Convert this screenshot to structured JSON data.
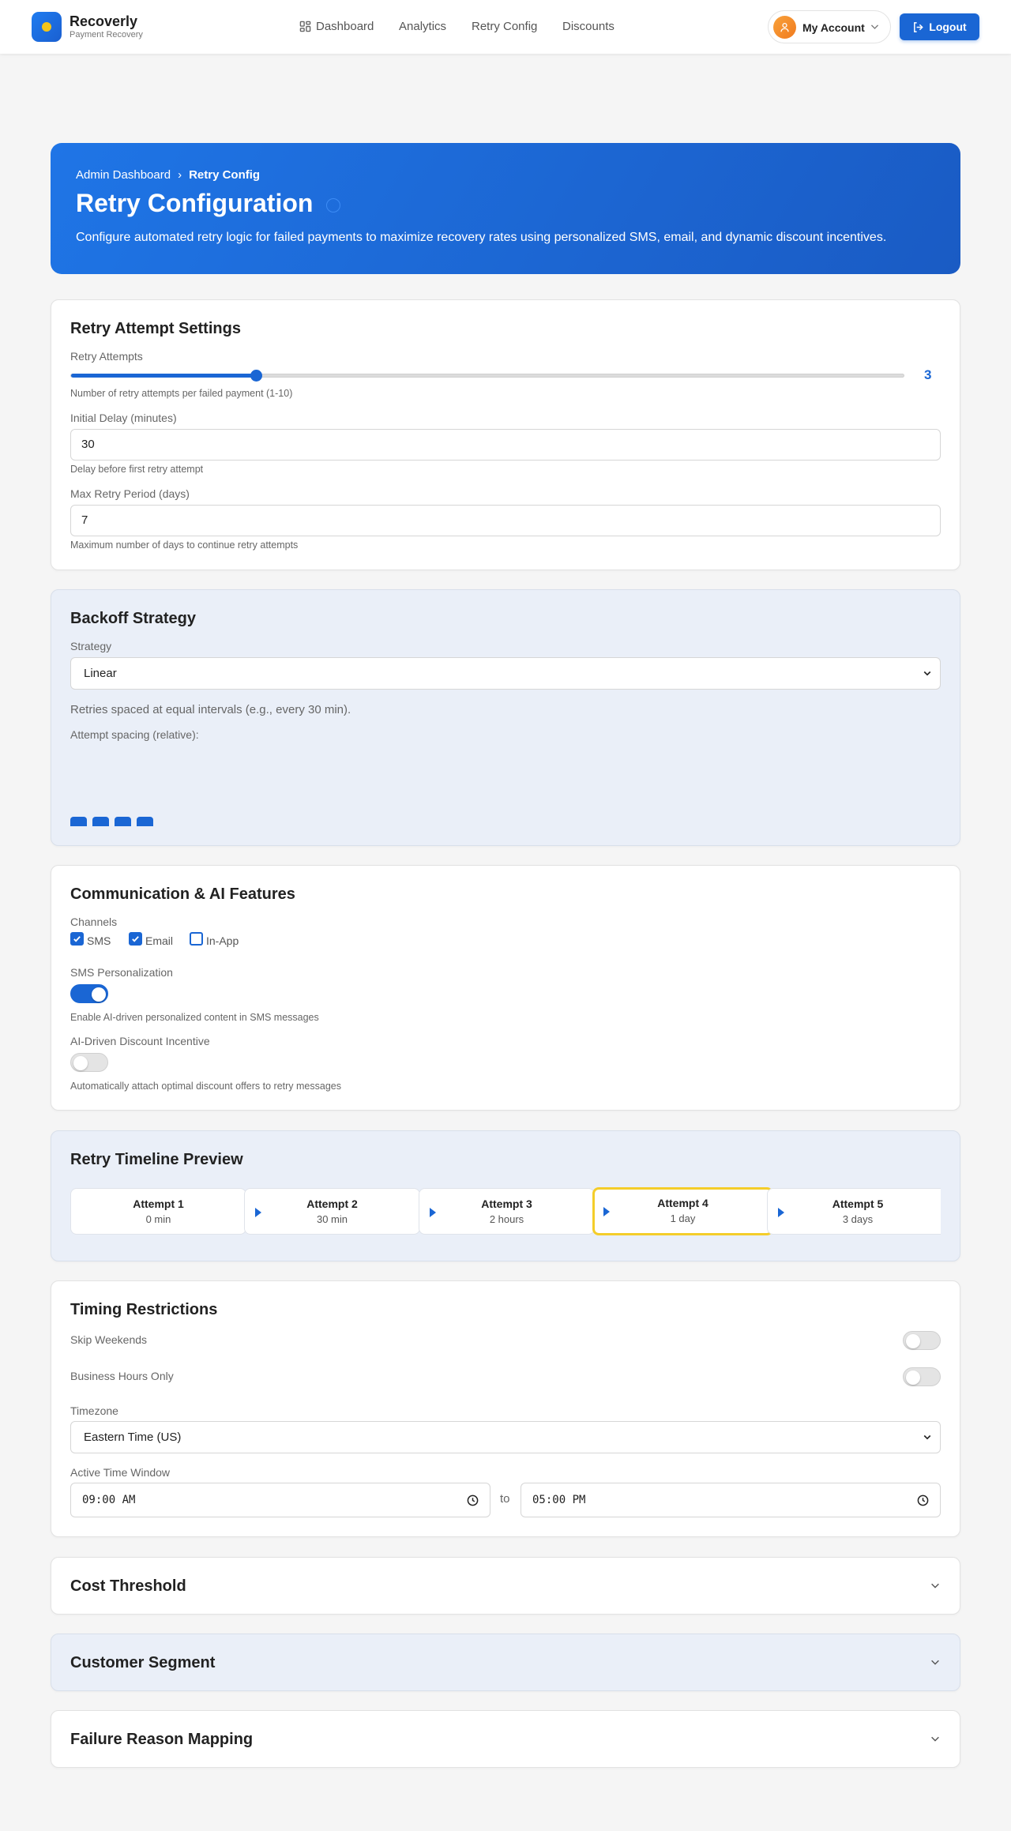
{
  "header": {
    "brand": "Recoverly",
    "brand_sub": "Payment Recovery",
    "nav": [
      {
        "label": "Dashboard",
        "icon": "dashboard-icon"
      },
      {
        "label": "Analytics"
      },
      {
        "label": "Retry Config"
      },
      {
        "label": "Discounts"
      }
    ],
    "account_label": "My Account",
    "logout_label": "Logout"
  },
  "hero": {
    "breadcrumb_parent": "Admin Dashboard",
    "breadcrumb_sep": "›",
    "breadcrumb_current": "Retry Config",
    "title": "Retry Configuration",
    "description": "Configure automated retry logic for failed payments to maximize recovery rates using personalized SMS, email, and dynamic discount incentives."
  },
  "retry_settings": {
    "title": "Retry Attempt Settings",
    "attempts_label": "Retry Attempts",
    "attempts_value": "3",
    "attempts_min": 1,
    "attempts_max": 10,
    "attempts_hint": "Number of retry attempts per failed payment (1-10)",
    "delay_label": "Initial Delay (minutes)",
    "delay_value": "30",
    "delay_hint": "Delay before first retry attempt",
    "period_label": "Max Retry Period (days)",
    "period_value": "7",
    "period_hint": "Maximum number of days to continue retry attempts"
  },
  "backoff": {
    "title": "Backoff Strategy",
    "strategy_label": "Strategy",
    "strategy_value": "Linear",
    "description": "Retries spaced at equal intervals (e.g., every 30 min).",
    "spacing_label": "Attempt spacing (relative):",
    "spacing_values": [
      1,
      1,
      1,
      1
    ]
  },
  "communication": {
    "title": "Communication & AI Features",
    "channels_label": "Channels",
    "channels": [
      {
        "label": "SMS",
        "checked": true
      },
      {
        "label": "Email",
        "checked": true
      },
      {
        "label": "In-App",
        "checked": false
      }
    ],
    "sms_label": "SMS Personalization",
    "sms_enabled": true,
    "sms_hint": "Enable AI-driven personalized content in SMS messages",
    "discount_label": "AI-Driven Discount Incentive",
    "discount_enabled": false,
    "discount_hint": "Automatically attach optimal discount offers to retry messages"
  },
  "timeline": {
    "title": "Retry Timeline Preview",
    "items": [
      {
        "name": "Attempt 1",
        "time": "0 min"
      },
      {
        "name": "Attempt 2",
        "time": "30 min"
      },
      {
        "name": "Attempt 3",
        "time": "2 hours"
      },
      {
        "name": "Attempt 4",
        "time": "1 day"
      },
      {
        "name": "Attempt 5",
        "time": "3 days"
      }
    ],
    "highlight_color": "#f4cd2a"
  },
  "timing": {
    "title": "Timing Restrictions",
    "skip_weekends_label": "Skip Weekends",
    "skip_weekends": false,
    "business_hours_label": "Business Hours Only",
    "business_hours": false,
    "timezone_label": "Timezone",
    "timezone_value": "Eastern Time (US)",
    "window_label": "Active Time Window",
    "window_start": "09:00 AM",
    "window_sep": "to",
    "window_end": "05:00 PM"
  },
  "collapsed_sections": [
    {
      "title": "Cost Threshold"
    },
    {
      "title": "Customer Segment"
    },
    {
      "title": "Failure Reason Mapping"
    }
  ],
  "colors": {
    "accent": "#1a66d4",
    "page_bg": "#f5f5f5",
    "alt_card_bg": "#eaeff8"
  }
}
